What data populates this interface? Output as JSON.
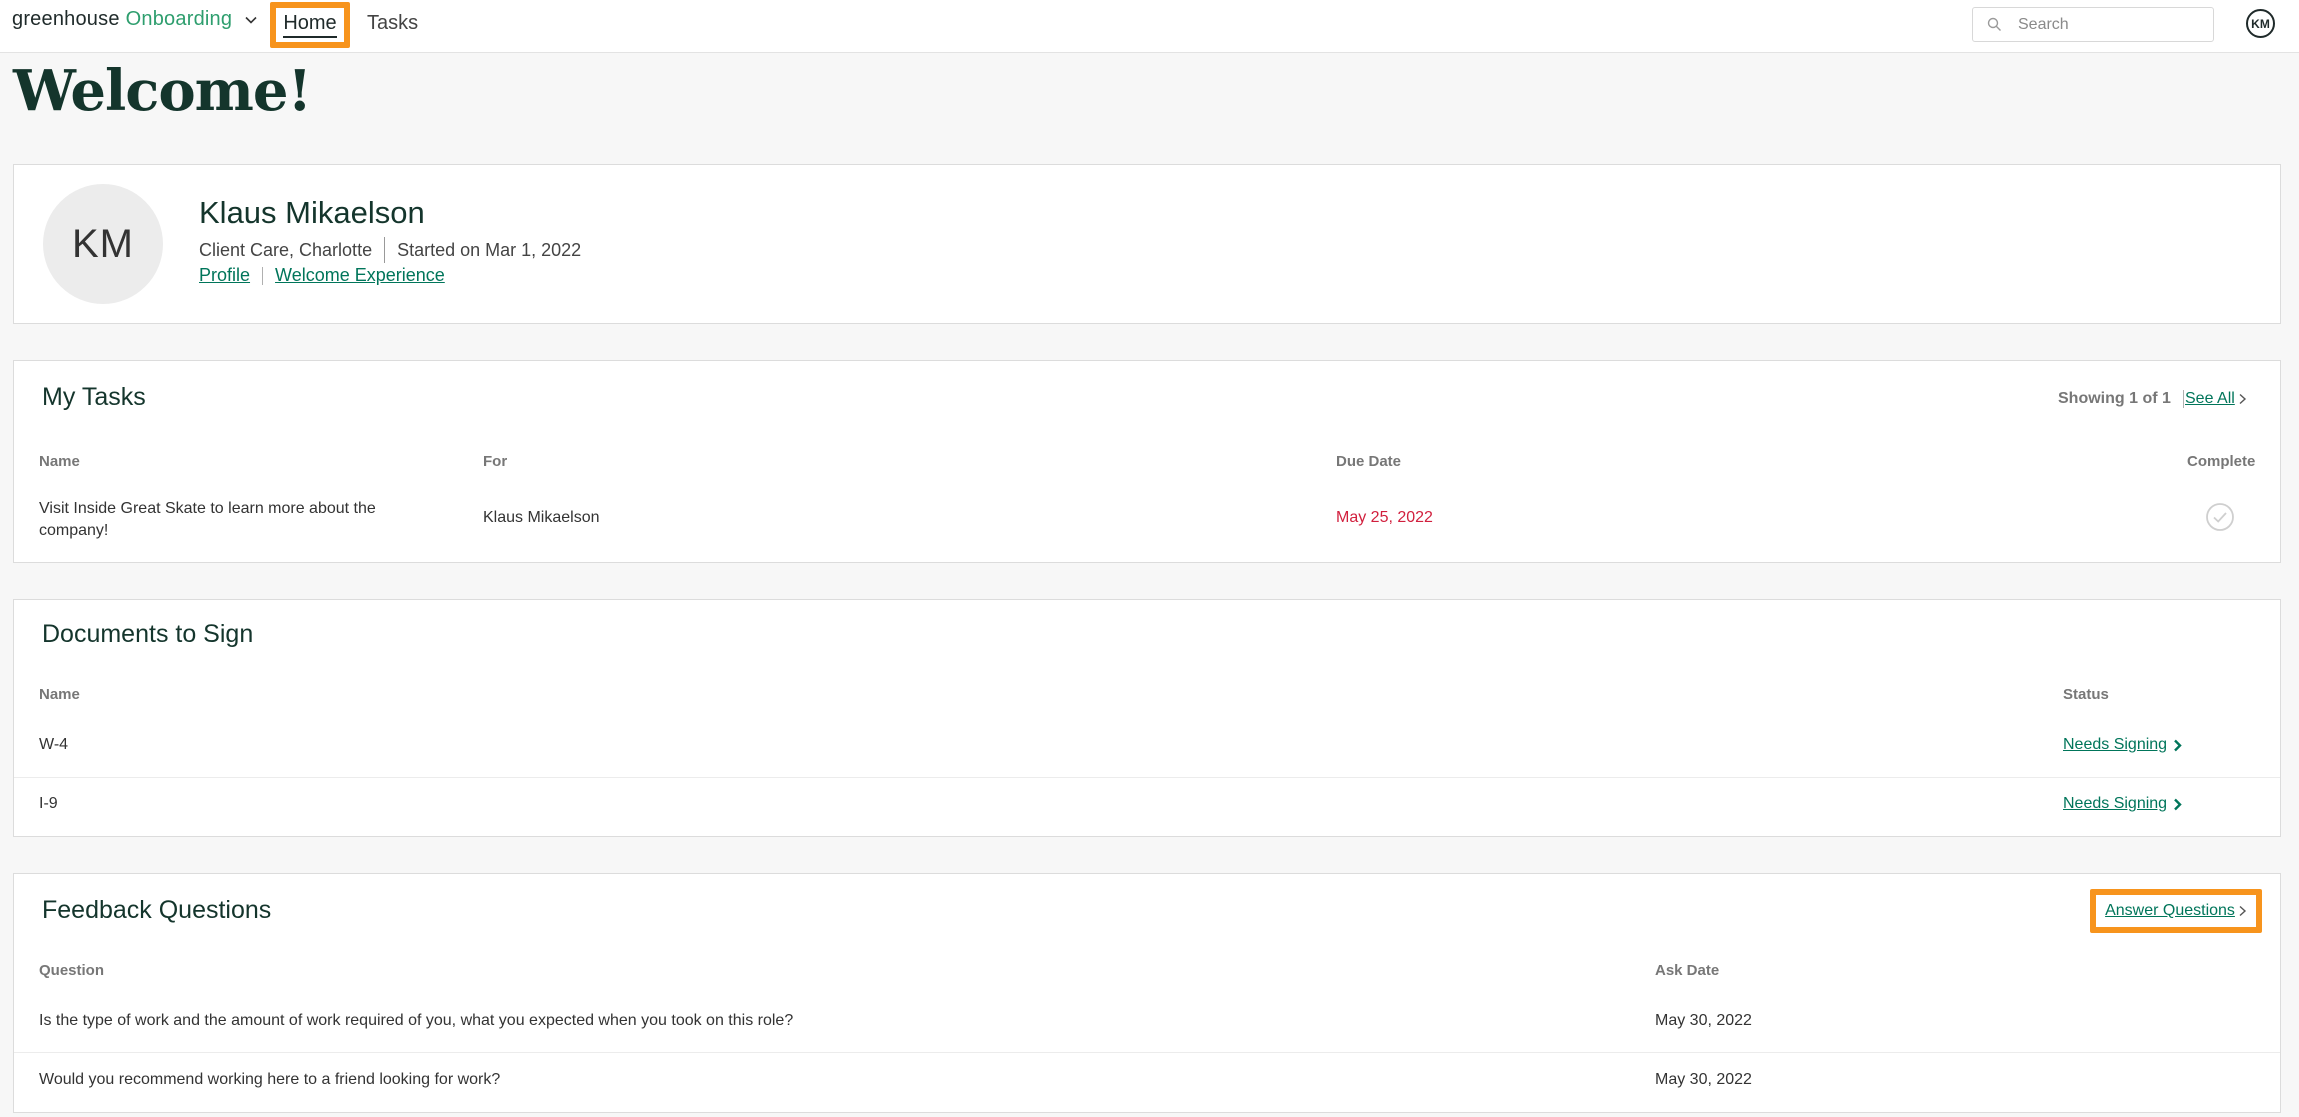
{
  "topbar": {
    "brand_main": "greenhouse",
    "brand_product": "Onboarding",
    "nav_home": "Home",
    "nav_tasks": "Tasks",
    "search_placeholder": "Search",
    "user_initials": "KM"
  },
  "page": {
    "title": "Welcome!"
  },
  "profile": {
    "initials": "KM",
    "name": "Klaus Mikaelson",
    "department_location": "Client Care, Charlotte",
    "start": "Started on Mar 1, 2022",
    "link_profile": "Profile",
    "link_welcome": "Welcome Experience"
  },
  "tasks": {
    "title": "My Tasks",
    "showing": "Showing 1 of 1",
    "see_all": "See All",
    "columns": {
      "name": "Name",
      "for": "For",
      "due": "Due Date",
      "complete": "Complete"
    },
    "rows": [
      {
        "name": "Visit Inside Great Skate to learn more about the company!",
        "for": "Klaus Mikaelson",
        "due": "May 25, 2022"
      }
    ]
  },
  "documents": {
    "title": "Documents to Sign",
    "columns": {
      "name": "Name",
      "status": "Status"
    },
    "rows": [
      {
        "name": "W-4",
        "status": "Needs Signing"
      },
      {
        "name": "I-9",
        "status": "Needs Signing"
      }
    ]
  },
  "feedback": {
    "title": "Feedback Questions",
    "answer_button": "Answer Questions",
    "columns": {
      "question": "Question",
      "ask_date": "Ask Date"
    },
    "rows": [
      {
        "question": "Is the type of work and the amount of work required of you, what you expected when you took on this role?",
        "ask_date": "May 30, 2022"
      },
      {
        "question": "Would you recommend working here to a friend looking for work?",
        "ask_date": "May 30, 2022"
      }
    ]
  },
  "colors": {
    "brand_green": "#2e9e6e",
    "link_green": "#00755a",
    "overdue_red": "#d11f3d",
    "highlight_orange": "#f7941d",
    "heading_dark": "#14352c"
  },
  "icons": {
    "brand_menu": "chevron-down-icon",
    "search": "search-icon",
    "see_all": "chevron-right-icon",
    "complete": "check-circle-icon",
    "sign": "chevron-right-bold-icon",
    "answer": "chevron-right-icon"
  }
}
